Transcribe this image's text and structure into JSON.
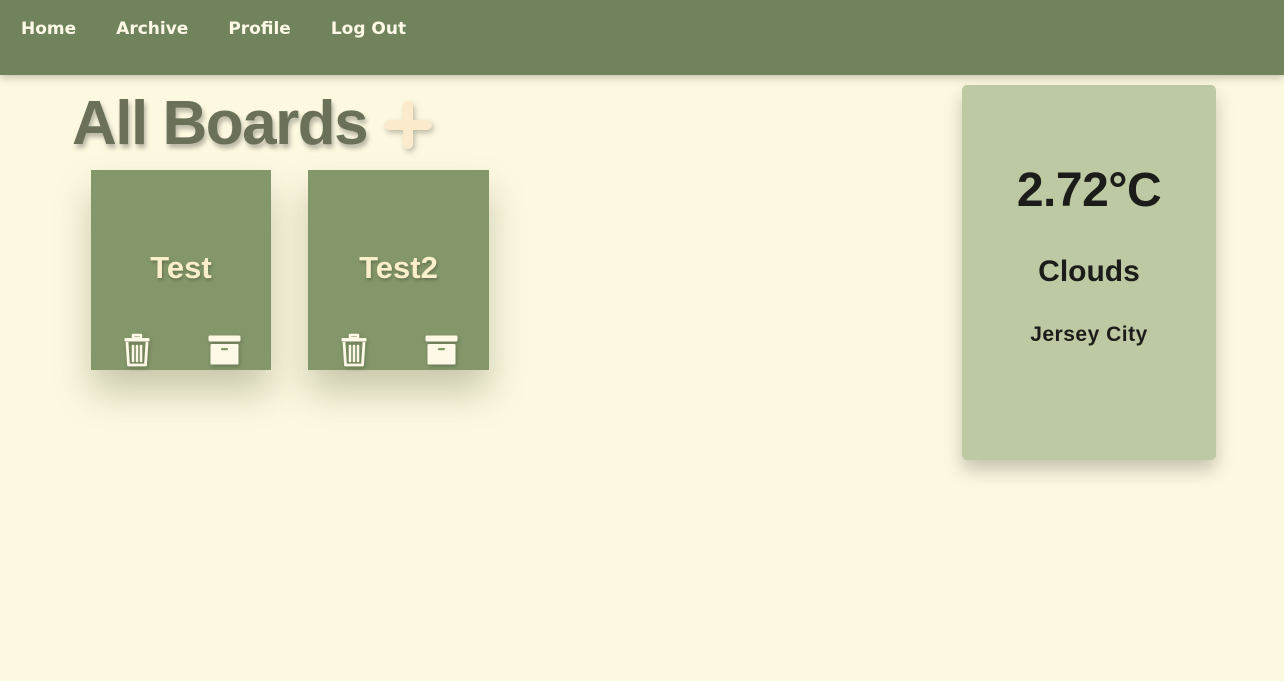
{
  "nav": {
    "items": [
      {
        "label": "Home"
      },
      {
        "label": "Archive"
      },
      {
        "label": "Profile"
      },
      {
        "label": "Log Out"
      }
    ]
  },
  "page": {
    "title": "All Boards",
    "add_icon": "plus-icon"
  },
  "boards": [
    {
      "title": "Test",
      "delete_icon": "trash-icon",
      "archive_icon": "archive-box-icon"
    },
    {
      "title": "Test2",
      "delete_icon": "trash-icon",
      "archive_icon": "archive-box-icon"
    }
  ],
  "weather": {
    "temperature": "2.72°C",
    "condition": "Clouds",
    "city": "Jersey City"
  },
  "colors": {
    "navbar": "#70835c",
    "background": "#fdf9e1",
    "board_card": "#84976a",
    "weather_card": "#bdc9a2",
    "title_text": "#6a7158",
    "accent_cream": "#fbeecb"
  }
}
